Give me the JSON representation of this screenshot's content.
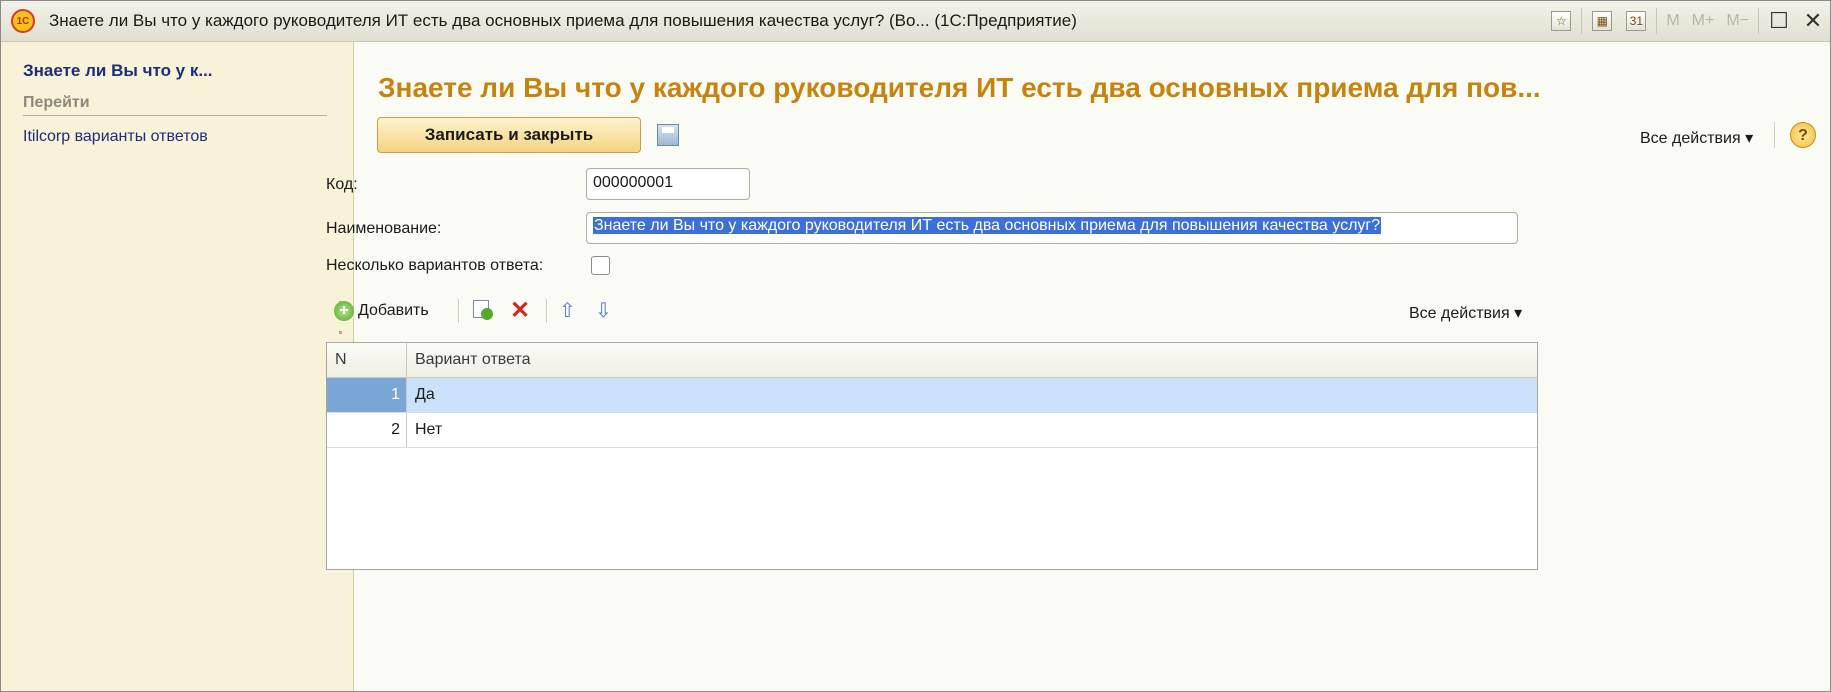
{
  "window": {
    "title": "Знаете ли Вы что у каждого руководителя ИТ есть два основных приема для повышения качества услуг? (Во...  (1С:Предприятие)",
    "logo_text": "1С",
    "memory_buttons": [
      "M",
      "M+",
      "M−"
    ]
  },
  "sidebar": {
    "title": "Знаете ли Вы что у к...",
    "section": "Перейти",
    "links": [
      "Itilcorp варианты ответов"
    ]
  },
  "form": {
    "title": "Знаете ли Вы что у каждого руководителя ИТ есть два основных приема для пов...",
    "save_close_label": "Записать и закрыть",
    "all_actions_label": "Все действия ▾",
    "help_label": "?",
    "fields": {
      "code_label": "Код:",
      "code_value": "000000001",
      "name_label": "Наименование:",
      "name_value": "Знаете ли Вы что у каждого руководителя ИТ есть два основных приема для повышения качества услуг?",
      "multi_label": "Несколько вариантов ответа:",
      "multi_checked": false
    }
  },
  "table": {
    "toolbar": {
      "add_label": "Добавить",
      "all_actions_label": "Все действия ▾"
    },
    "columns": [
      "N",
      "Вариант ответа"
    ],
    "rows": [
      {
        "n": "1",
        "answer": "Да",
        "selected": true
      },
      {
        "n": "2",
        "answer": "Нет",
        "selected": false
      }
    ]
  },
  "colors": {
    "title_orange": "#c8830f",
    "link_blue": "#1c2d7a",
    "sidebar_bg": "#f7f2d8",
    "selection_blue": "#c9e1fb"
  }
}
